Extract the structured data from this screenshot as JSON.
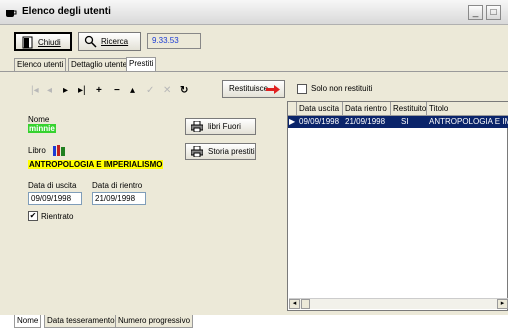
{
  "window": {
    "title": "Elenco degli utenti",
    "icon": "cup-icon",
    "controls": [
      "_",
      "□"
    ]
  },
  "toolbar": {
    "close_label": "Chiudi",
    "search_label": "Ricerca",
    "clock": "9.33.53"
  },
  "tabs": [
    "Elenco utenti",
    "Dettaglio utente",
    "Prestiti"
  ],
  "active_tab": "Prestiti",
  "nav_buttons": [
    "first",
    "prev",
    "next",
    "last",
    "add",
    "delete",
    "up",
    "check",
    "cancel",
    "refresh"
  ],
  "form": {
    "restituisce_label": "Restituisce",
    "solo_label": "Solo non restituiti",
    "nome_label": "Nome",
    "nome_value": "minnie",
    "libri_fuori_label": "libri Fuori",
    "libro_label": "Libro",
    "libro_value": "ANTROPOLOGIA E IMPERIALISMO",
    "storia_label": "Storia prestiti",
    "data_uscita_label": "Data di uscita",
    "data_uscita_value": "09/09/1998",
    "data_rientro_label": "Data di rientro",
    "data_rientro_value": "21/09/1998",
    "rientrato_label": "Rientrato",
    "rientrato_checked": "✔"
  },
  "grid": {
    "columns": [
      "Data uscita",
      "Data rientro",
      "Restituito",
      "Titolo"
    ],
    "rows": [
      [
        "09/09/1998",
        "21/09/1998",
        "SI",
        "ANTROPOLOGIA E IMPE"
      ]
    ]
  },
  "bottom_tabs": [
    "Nome",
    "Data tesseramento",
    "Numero progressivo"
  ],
  "colors": {
    "name_highlight": "#36d22f",
    "book_highlight": "#ffff00",
    "clock_text": "#1a3bd6",
    "arrow_red": "#e02020"
  }
}
